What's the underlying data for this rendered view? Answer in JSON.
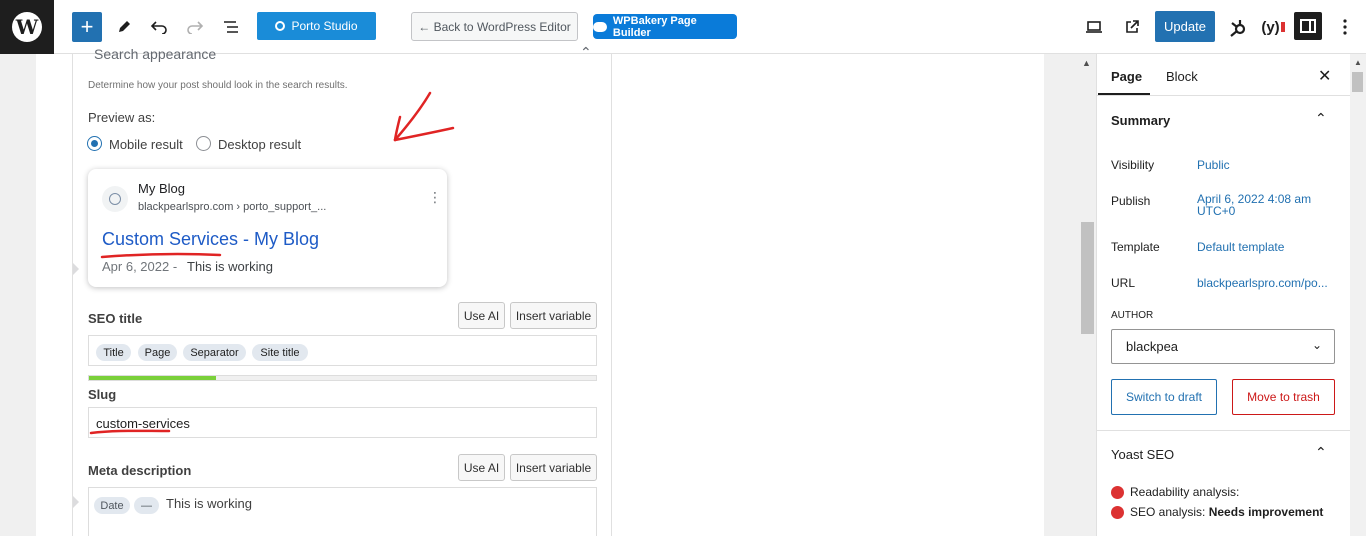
{
  "toolbar": {
    "porto_label": "Porto Studio",
    "back_label": "← Back to WordPress Editor",
    "wpbakery_label": "WPBakery Page Builder",
    "update_label": "Update",
    "yoast_label": "(y)"
  },
  "search_appearance": {
    "heading": "Search appearance",
    "description": "Determine how your post should look in the search results.",
    "preview_as_label": "Preview as:",
    "options": [
      {
        "label": "Mobile result",
        "selected": true
      },
      {
        "label": "Desktop result",
        "selected": false
      }
    ]
  },
  "serp_preview": {
    "site_name": "My Blog",
    "url": "blackpearlspro.com › porto_support_...",
    "title": "Custom Services - My Blog",
    "date": "Apr 6, 2022  -",
    "description": "This is working"
  },
  "seo_title": {
    "label": "SEO title",
    "use_ai_label": "Use AI",
    "insert_variable_label": "Insert variable",
    "variables": [
      "Title",
      "Page",
      "Separator",
      "Site title"
    ],
    "progress_fraction": 0.25,
    "progress_color": "#7ad03a"
  },
  "slug": {
    "label": "Slug",
    "value": "custom-services"
  },
  "meta_description": {
    "label": "Meta description",
    "use_ai_label": "Use AI",
    "insert_variable_label": "Insert variable",
    "variables": [
      "Date",
      "—"
    ],
    "text": "This is working"
  },
  "sidebar": {
    "tabs": [
      "Page",
      "Block"
    ],
    "active_tab": "Page",
    "summary_heading": "Summary",
    "rows": [
      {
        "label": "Visibility",
        "value": "Public"
      },
      {
        "label": "Publish",
        "value": "April 6, 2022 4:08 am UTC+0"
      },
      {
        "label": "Template",
        "value": "Default template"
      },
      {
        "label": "URL",
        "value": "blackpearlspro.com/po..."
      }
    ],
    "publish_line1": "April 6, 2022 4:08 am",
    "publish_line2": "UTC+0",
    "author_label": "AUTHOR",
    "author_value": "blackpea",
    "switch_draft_label": "Switch to draft",
    "trash_label": "Move to trash",
    "yoast_heading": "Yoast SEO",
    "readability_label": "Readability analysis:",
    "seo_analysis_label": "SEO analysis:",
    "seo_analysis_value": "Needs improvement"
  },
  "colors": {
    "accent": "#2271b1",
    "porto": "#1a8cd8",
    "wpbakery": "#0a7bd9",
    "danger": "#cc1818",
    "annotation": "#e02424"
  }
}
